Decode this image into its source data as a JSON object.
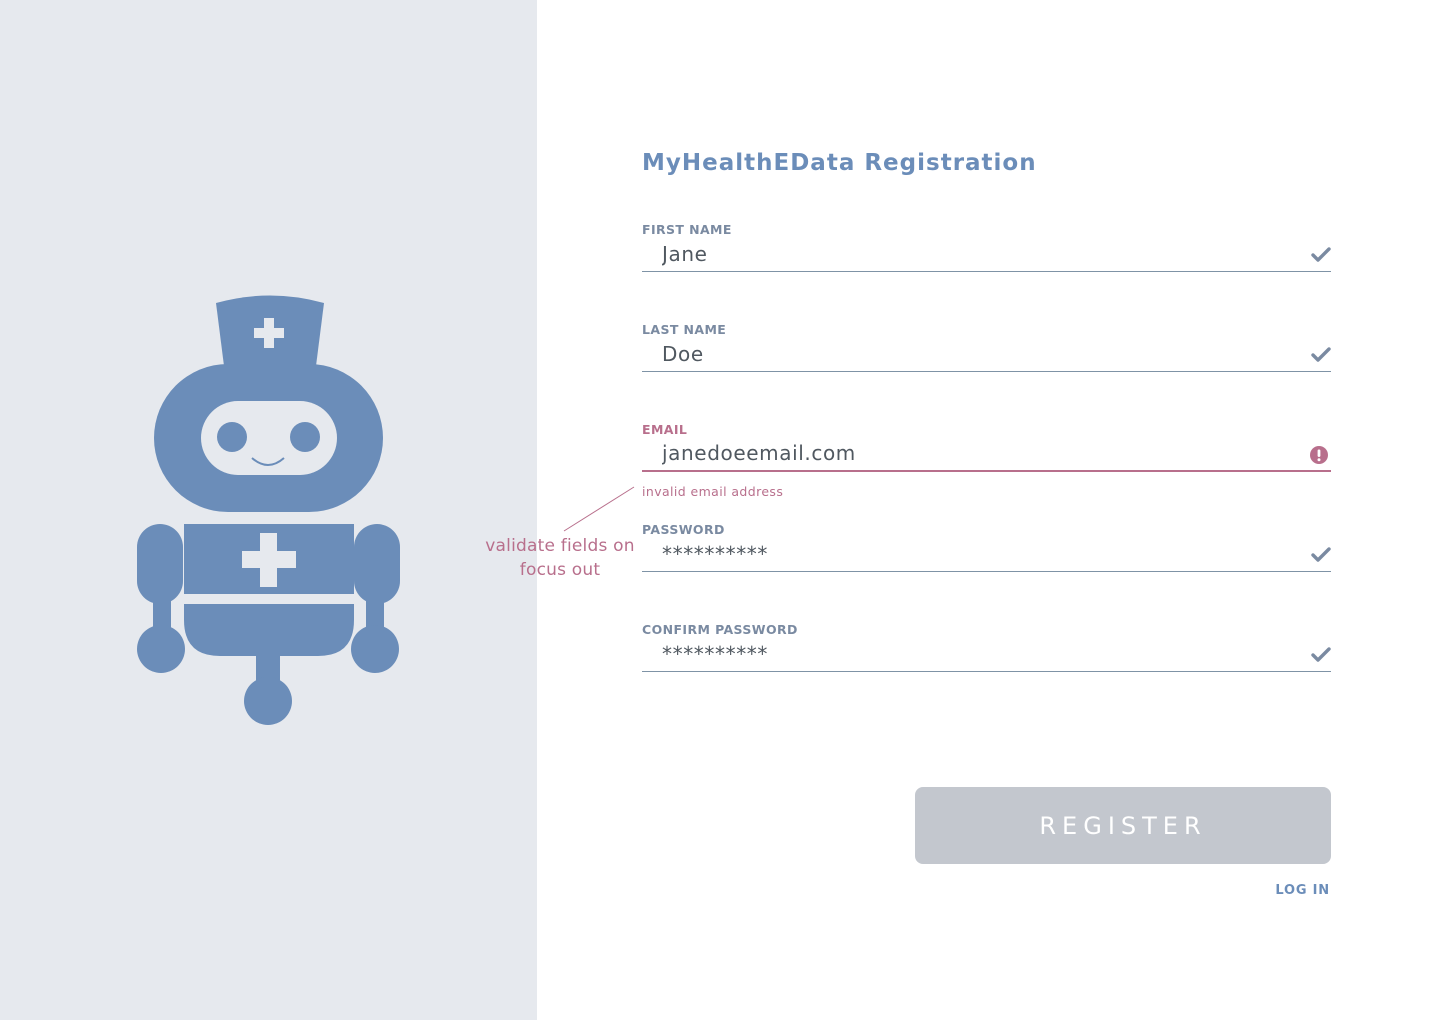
{
  "app": {
    "title": "MyHealthEData Registration"
  },
  "colors": {
    "accent": "#6b8db9",
    "error": "#b86f8c",
    "left_panel_bg": "#e6e9ee",
    "button_disabled": "#c3c7ce"
  },
  "annotation": {
    "text": "validate fields on focus out"
  },
  "form": {
    "first_name": {
      "label": "FIRST NAME",
      "value": "Jane",
      "status_icon": "check-icon"
    },
    "last_name": {
      "label": "LAST NAME",
      "value": "Doe",
      "status_icon": "check-icon"
    },
    "email": {
      "label": "EMAIL",
      "value": "janedoeemail.com",
      "status_icon": "exclamation-circle-icon",
      "error": "invalid email address"
    },
    "password": {
      "label": "PASSWORD",
      "value": "**********",
      "status_icon": "check-icon"
    },
    "confirm_password": {
      "label": "CONFIRM PASSWORD",
      "value": "**********",
      "status_icon": "check-icon"
    },
    "register_label": "REGISTER",
    "login_label": "LOG IN"
  }
}
